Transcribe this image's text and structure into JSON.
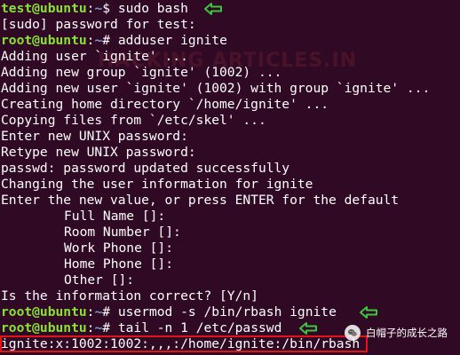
{
  "terminal": {
    "lines": [
      {
        "type": "prompt",
        "user_host": "test@ubuntu",
        "path": "~",
        "symbol": "$",
        "command": "sudo bash",
        "arrow": true
      },
      {
        "type": "output",
        "text": "[sudo] password for test:"
      },
      {
        "type": "prompt",
        "user_host": "root@ubuntu",
        "path": "~",
        "symbol": "#",
        "command": "adduser ignite",
        "arrow": false
      },
      {
        "type": "output",
        "text": "Adding user `ignite' ..."
      },
      {
        "type": "output",
        "text": "Adding new group `ignite' (1002) ..."
      },
      {
        "type": "output",
        "text": "Adding new user `ignite' (1002) with group `ignite' ..."
      },
      {
        "type": "output",
        "text": "Creating home directory `/home/ignite' ..."
      },
      {
        "type": "output",
        "text": "Copying files from `/etc/skel' ..."
      },
      {
        "type": "output",
        "text": "Enter new UNIX password:"
      },
      {
        "type": "output",
        "text": "Retype new UNIX password:"
      },
      {
        "type": "output",
        "text": "passwd: password updated successfully"
      },
      {
        "type": "output",
        "text": "Changing the user information for ignite"
      },
      {
        "type": "output",
        "text": "Enter the new value, or press ENTER for the default"
      },
      {
        "type": "indented",
        "text": "Full Name []:"
      },
      {
        "type": "indented",
        "text": "Room Number []:"
      },
      {
        "type": "indented",
        "text": "Work Phone []:"
      },
      {
        "type": "indented",
        "text": "Home Phone []:"
      },
      {
        "type": "indented",
        "text": "Other []:"
      },
      {
        "type": "output",
        "text": "Is the information correct? [Y/n]"
      },
      {
        "type": "prompt",
        "user_host": "root@ubuntu",
        "path": "~",
        "symbol": "#",
        "command": "usermod -s /bin/rbash ignite",
        "arrow": true
      },
      {
        "type": "prompt",
        "user_host": "root@ubuntu",
        "path": "~",
        "symbol": "#",
        "command": "tail -n 1 /etc/passwd",
        "arrow": true
      },
      {
        "type": "output",
        "text": "ignite:x:1002:1002:,,,:/home/ignite:/bin/rbash",
        "highlighted": true
      }
    ]
  },
  "watermark": {
    "text": "HACKING ARTICLES.IN"
  },
  "brand": {
    "text": "白帽子的成长之路",
    "icon": "wechat-icon"
  },
  "colors": {
    "background": "#300a24",
    "prompt_user": "#8ae234",
    "prompt_path": "#729fcf",
    "text": "#ffffff",
    "arrow": "#3ec43e",
    "highlight_border": "#e0151a"
  }
}
